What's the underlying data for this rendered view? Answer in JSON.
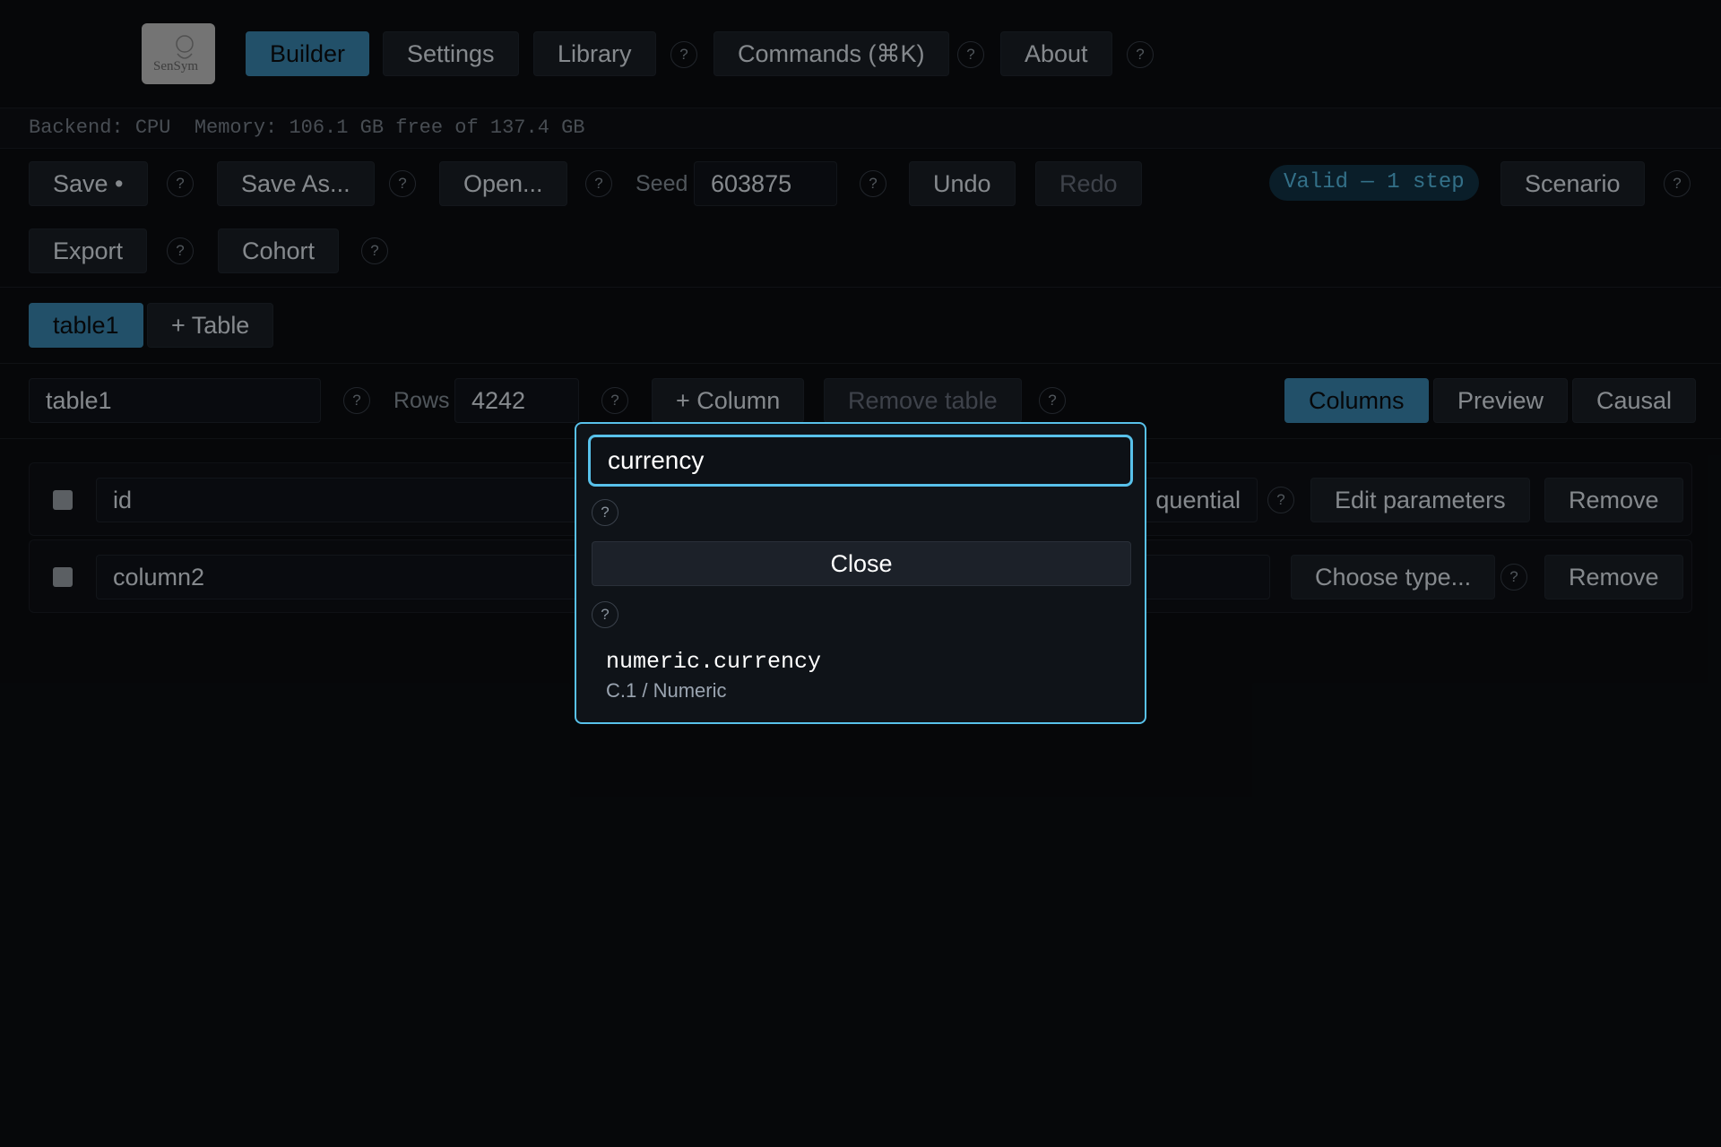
{
  "logo": {
    "text": "SenSym"
  },
  "nav": {
    "builder": "Builder",
    "settings": "Settings",
    "library": "Library",
    "commands": "Commands (⌘K)",
    "about": "About",
    "help": "?"
  },
  "status": {
    "text": "Backend: CPU  Memory: 106.1 GB free of 137.4 GB"
  },
  "toolbar": {
    "save": "Save •",
    "save_as": "Save As...",
    "open": "Open...",
    "seed_label": "Seed",
    "seed_value": "603875",
    "undo": "Undo",
    "redo": "Redo",
    "valid_badge": "Valid — 1 step",
    "scenario": "Scenario",
    "export": "Export",
    "cohort": "Cohort"
  },
  "tables": {
    "tabs": [
      "table1"
    ],
    "add_table": "+ Table"
  },
  "table_editor": {
    "name": "table1",
    "rows_label": "Rows",
    "rows_value": "4242",
    "add_column": "+ Column",
    "remove_table": "Remove table",
    "view_tabs": [
      "Columns",
      "Preview",
      "Causal"
    ]
  },
  "columns": [
    {
      "name": "id",
      "type_suffix": "quential",
      "edit": "Edit parameters",
      "remove": "Remove"
    },
    {
      "name": "column2",
      "choose_type": "Choose type...",
      "remove": "Remove"
    }
  ],
  "type_picker": {
    "search_value": "currency",
    "close": "Close",
    "result": {
      "name": "numeric.currency",
      "category": "C.1 / Numeric"
    }
  }
}
